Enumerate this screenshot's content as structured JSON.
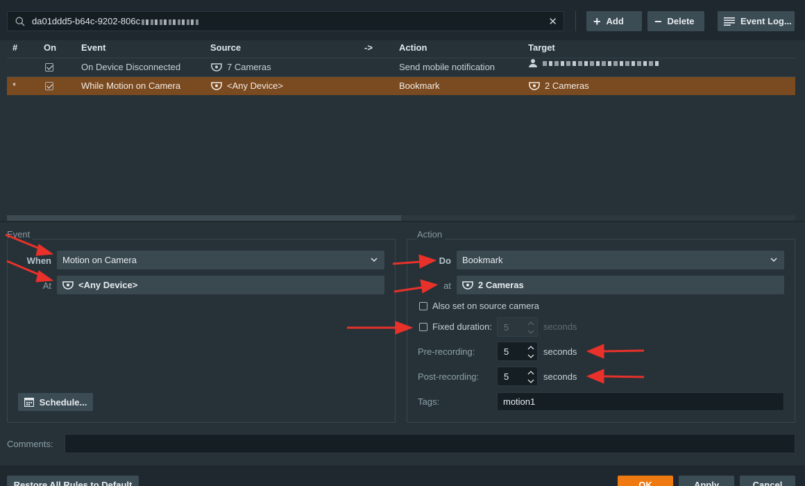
{
  "toolbar": {
    "search_value": "da01ddd5-b64c-9202-806c",
    "clear_icon": "close-icon",
    "add_label": "Add",
    "delete_label": "Delete",
    "event_log_label": "Event Log..."
  },
  "table": {
    "headers": {
      "num": "#",
      "on": "On",
      "event": "Event",
      "source": "Source",
      "arrow": "->",
      "action": "Action",
      "target": "Target"
    },
    "rows": [
      {
        "marker": "",
        "on": true,
        "event": "On Device Disconnected",
        "source": "7 Cameras",
        "action": "Send mobile notification",
        "target": "",
        "target_icon": "user-icon",
        "selected": false
      },
      {
        "marker": "*",
        "on": true,
        "event": "While Motion on Camera",
        "source": "<Any Device>",
        "action": "Bookmark",
        "target": "2 Cameras",
        "target_icon": "camera-icon",
        "selected": true
      }
    ]
  },
  "event_panel": {
    "title": "Event",
    "when_label": "When",
    "when_value": "Motion on Camera",
    "at_label": "At",
    "at_value": "<Any Device>",
    "schedule_label": "Schedule..."
  },
  "action_panel": {
    "title": "Action",
    "do_label": "Do",
    "do_value": "Bookmark",
    "at_label": "at",
    "at_value": "2 Cameras",
    "also_set_label": "Also set on source camera",
    "fixed_duration_label": "Fixed duration:",
    "fixed_duration_value": "5",
    "fixed_duration_unit": "seconds",
    "pre_recording_label": "Pre-recording:",
    "pre_recording_value": "5",
    "pre_recording_unit": "seconds",
    "post_recording_label": "Post-recording:",
    "post_recording_value": "5",
    "post_recording_unit": "seconds",
    "tags_label": "Tags:",
    "tags_value": "motion1"
  },
  "comments": {
    "label": "Comments:",
    "value": ""
  },
  "footer": {
    "restore_label": "Restore All Rules to Default",
    "ok_label": "OK",
    "apply_label": "Apply",
    "cancel_label": "Cancel"
  },
  "colors": {
    "background": "#263238",
    "selected_row": "#7a4a20",
    "ok_button": "#f07a12",
    "annotation_arrow": "#e8312a"
  }
}
